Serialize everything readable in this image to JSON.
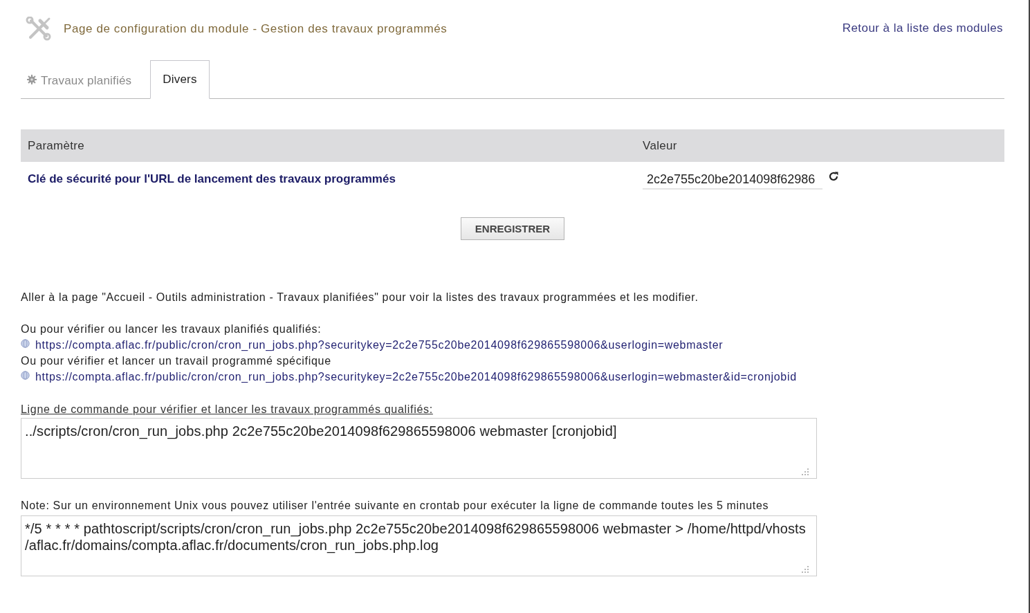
{
  "header": {
    "title": "Page de configuration du module - Gestion des travaux programmés",
    "back_link": "Retour à la liste des modules"
  },
  "tabs": [
    {
      "label": "Travaux planifiés",
      "selected": false,
      "kind": "iconic"
    },
    {
      "label": "Divers",
      "selected": true,
      "kind": "plain"
    }
  ],
  "table": {
    "columns": [
      "Paramètre",
      "Valeur"
    ],
    "rows": [
      {
        "parameter": "Clé de sécurité pour l'URL de lancement des travaux programmés",
        "value": "2c2e755c20be2014098f62986"
      }
    ]
  },
  "save_button": "ENREGISTRER",
  "info": {
    "intro": "Aller à la page \"Accueil - Outils administration - Travaux planifiées\" pour voir la listes des travaux programmées et les modifier.",
    "links": [
      {
        "caption": "Ou pour vérifier ou lancer les travaux planifiés qualifiés:",
        "url": "https://compta.aflac.fr/public/cron/cron_run_jobs.php?securitykey=2c2e755c20be2014098f629865598006&userlogin=webmaster"
      },
      {
        "caption": "Ou pour vérifier et lancer un travail programmé spécifique",
        "url": "https://compta.aflac.fr/public/cron/cron_run_jobs.php?securitykey=2c2e755c20be2014098f629865598006&userlogin=webmaster&id=cronjobid"
      }
    ]
  },
  "command_line": {
    "label": "Ligne de commande pour vérifier et lancer les travaux programmés qualifiés:",
    "lines": [
      "../scripts/cron/cron_run_jobs.php 2c2e755c20be2014098f629865598006 webmaster [cronjobid]"
    ]
  },
  "crontab": {
    "note": "Note: Sur un environnement Unix vous pouvez utiliser l'entrée suivante en crontab pour exécuter la ligne de commande toutes les 5 minutes",
    "lines": [
      "*/5 * * * * pathtoscript/scripts/cron/cron_run_jobs.php 2c2e755c20be2014098f629865598006 webmaster > /home/httpd/vhosts",
      "/aflac.fr/domains/compta.aflac.fr/documents/cron_run_jobs.php.log"
    ]
  }
}
